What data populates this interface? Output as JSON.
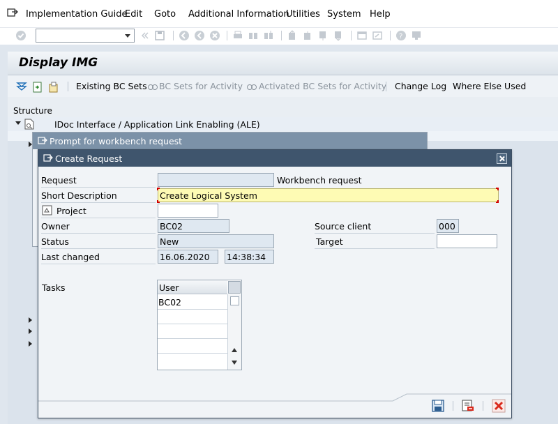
{
  "menu": {
    "items": [
      "Implementation Guide",
      "Edit",
      "Goto",
      "Additional Information",
      "Utilities",
      "System",
      "Help"
    ]
  },
  "toolbar": {
    "command_field": ""
  },
  "page": {
    "title": "Display IMG"
  },
  "app_toolbar": {
    "existing_bc_sets": "Existing BC Sets",
    "bc_sets_for_activity": "BC Sets for Activity",
    "activated_bc_sets": "Activated BC Sets for Activity",
    "change_log": "Change Log",
    "where_else_used": "Where Else Used"
  },
  "tree": {
    "header": "Structure",
    "node_label": "IDoc Interface / Application Link Enabling (ALE)"
  },
  "prompt_dialog": {
    "title": "Prompt for workbench request"
  },
  "create_request": {
    "title": "Create Request",
    "request_label": "Request",
    "request_value": "",
    "request_type": "Workbench request",
    "short_desc_label": "Short Description",
    "short_desc_value": "Create Logical System",
    "project_label": "Project",
    "project_value": "",
    "owner_label": "Owner",
    "owner_value": "BC02",
    "source_client_label": "Source client",
    "source_client_value": "000",
    "status_label": "Status",
    "status_value": "New",
    "target_label": "Target",
    "target_value": "",
    "last_changed_label": "Last changed",
    "last_changed_date": "16.06.2020",
    "last_changed_time": "14:38:34",
    "tasks_label": "Tasks",
    "tasks_column": "User",
    "tasks_rows": [
      "BC02",
      "",
      "",
      "",
      ""
    ]
  },
  "colors": {
    "dialog_title_bg": "#3f556d",
    "required_field_bg": "#fefbb4",
    "close_red": "#d9291c"
  }
}
